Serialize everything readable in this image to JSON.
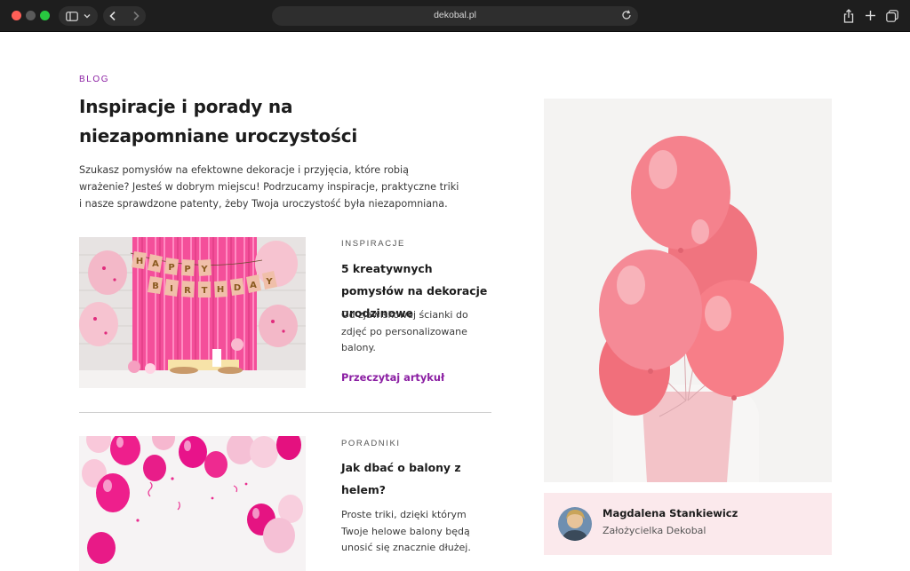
{
  "browser": {
    "url": "dekobal.pl",
    "icons": [
      "sidebar-icon",
      "chevron-down-icon",
      "back-icon",
      "forward-icon",
      "reload-icon",
      "share-icon",
      "new-tab-icon",
      "tabs-overview-icon"
    ]
  },
  "blog": {
    "eyebrow": "BLOG",
    "title": "Inspiracje i porady na niezapomniane uroczystości",
    "intro": "Szukasz pomysłów na efektowne dekoracje i przyjęcia, które robią wrażenie? Jesteś w dobrym miejscu! Podrzucamy inspiracje, praktyczne triki i nasze sprawdzone patenty, żeby Twoja uroczystość była niezapomniana."
  },
  "articles": [
    {
      "category": "INSPIRACJE",
      "title": "5 kreatywnych pomysłów na dekoracje urodzinowe",
      "excerpt": "Od zjawiskowej ścianki do zdjęć po personalizowane balony.",
      "link": "Przeczytaj artykuł",
      "image_banner_letters": [
        "H",
        "A",
        "P",
        "P",
        "Y",
        "B",
        "I",
        "R",
        "T",
        "H",
        "D",
        "A",
        "Y"
      ]
    },
    {
      "category": "PORADNIKI",
      "title": "Jak dbać o balony z helem?",
      "excerpt": "Proste triki, dzięki którym Twoje helowe balony będą unosić się znacznie dłużej."
    }
  ],
  "author": {
    "name": "Magdalena Stankiewicz",
    "role": "Założycielka Dekobal"
  },
  "colors": {
    "accent": "#8b1fa3",
    "author_card_bg": "#fbe9ec",
    "balloon_pink": "#f27f8c"
  }
}
